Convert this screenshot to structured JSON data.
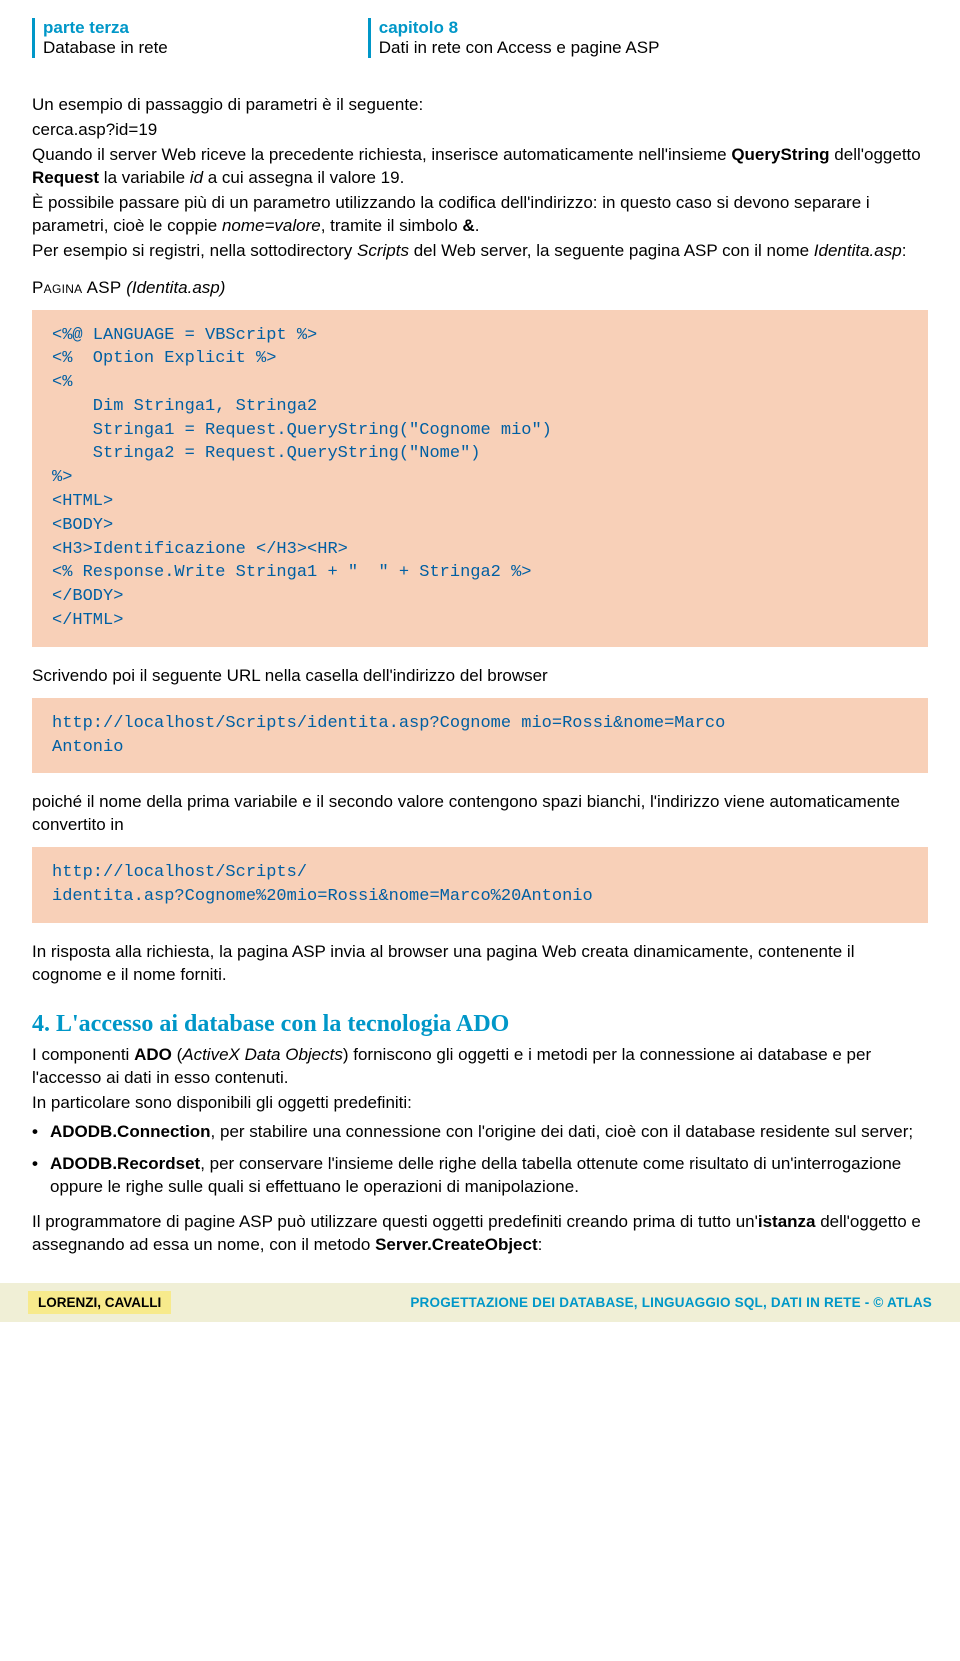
{
  "header": {
    "left_top": "parte terza",
    "left_bottom": "Database in rete",
    "right_top": "capitolo 8",
    "right_bottom": "Dati in rete con Access e pagine ASP"
  },
  "p1": "Un esempio di passaggio di parametri è il seguente:",
  "p1_code": "cerca.asp?id=19",
  "p2a": "Quando il server Web riceve la precedente richiesta, inserisce automaticamente nell'insieme ",
  "p2b": "QueryString",
  "p2c": " dell'oggetto ",
  "p2d": "Request",
  "p2e": " la variabile ",
  "p2f": "id",
  "p2g": " a cui assegna il valore 19.",
  "p3a": "È possibile passare più di un parametro utilizzando la codifica dell'indirizzo: in questo caso si devono separare i parametri, cioè le coppie ",
  "p3b": "nome=valore",
  "p3c": ", tramite il simbolo ",
  "p3d": "&",
  "p3e": ".",
  "p4a": "Per esempio si registri, nella sottodirectory ",
  "p4b": "Scripts",
  "p4c": " del Web server, la seguente pagina ASP con il nome ",
  "p4d": "Identita.asp",
  "p4e": ":",
  "label1a": "Pagina ASP",
  "label1b": " (Identita.asp)",
  "code1": "<%@ LANGUAGE = VBScript %>\n<%  Option Explicit %>\n<%\n    Dim Stringa1, Stringa2\n    Stringa1 = Request.QueryString(\"Cognome mio\")\n    Stringa2 = Request.QueryString(\"Nome\")\n%>\n<HTML>\n<BODY>\n<H3>Identificazione </H3><HR>\n<% Response.Write Stringa1 + \"  \" + Stringa2 %>\n</BODY>\n</HTML>",
  "p5": "Scrivendo poi il seguente URL nella casella dell'indirizzo del browser",
  "code2": "http://localhost/Scripts/identita.asp?Cognome mio=Rossi&nome=Marco\nAntonio",
  "p6": "poiché il nome della prima variabile e il secondo valore contengono spazi bianchi, l'indirizzo viene automaticamente convertito in",
  "code3": "http://localhost/Scripts/\nidentita.asp?Cognome%20mio=Rossi&nome=Marco%20Antonio",
  "p7": "In risposta alla richiesta, la pagina ASP invia al browser una pagina Web creata dinamicamente, contenente il cognome e il nome forniti.",
  "section_title": "4. L'accesso ai database con la tecnologia ADO",
  "p8a": "I componenti ",
  "p8b": "ADO",
  "p8c": " (",
  "p8d": "ActiveX Data Objects",
  "p8e": ") forniscono gli oggetti e i metodi per la connessione ai database e per l'accesso ai dati in esso contenuti.",
  "p9": "In particolare sono disponibili gli oggetti predefiniti:",
  "b1a": "ADODB.Connection",
  "b1b": ", per stabilire una connessione con l'origine dei dati, cioè con il database residente sul server;",
  "b2a": "ADODB.Recordset",
  "b2b": ", per conservare l'insieme delle righe della tabella ottenute come risultato di un'interrogazione oppure le righe sulle quali si effettuano le operazioni di manipolazione.",
  "p10a": "Il programmatore di pagine ASP può utilizzare questi oggetti predefiniti creando prima di tutto un'",
  "p10b": "istanza",
  "p10c": " dell'oggetto e assegnando ad essa un nome, con il metodo ",
  "p10d": "Server.CreateObject",
  "p10e": ":",
  "footer": {
    "left": "LORENZI, CAVALLI",
    "right": "PROGETTAZIONE DEI DATABASE, LINGUAGGIO SQL, DATI IN RETE - © ATLAS"
  }
}
